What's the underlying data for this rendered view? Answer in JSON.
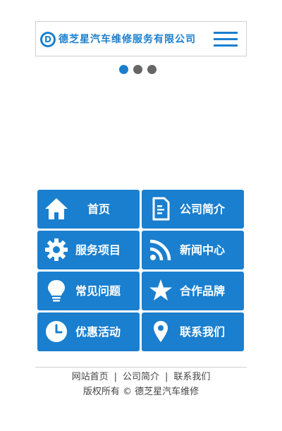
{
  "header": {
    "logo_letter": "D",
    "site_name": "德芝星汽车维修服务有限公司",
    "menu_icon": "hamburger-menu-icon"
  },
  "slider": {
    "dots": 3,
    "active_index": 0
  },
  "tiles": [
    {
      "label": "首页",
      "icon": "home-icon"
    },
    {
      "label": "公司简介",
      "icon": "document-icon"
    },
    {
      "label": "服务项目",
      "icon": "gear-icon"
    },
    {
      "label": "新闻中心",
      "icon": "rss-icon"
    },
    {
      "label": "常见问题",
      "icon": "lightbulb-icon"
    },
    {
      "label": "合作品牌",
      "icon": "star-icon"
    },
    {
      "label": "优惠活动",
      "icon": "clock-icon"
    },
    {
      "label": "联系我们",
      "icon": "location-pin-icon"
    }
  ],
  "footer": {
    "links": [
      "网站首页",
      "公司简介",
      "联系我们"
    ],
    "separator": "|",
    "copyright": "版权所有 © 德芝星汽车维修"
  },
  "colors": {
    "accent": "#1a7fcf",
    "dot_inactive": "#666666"
  }
}
